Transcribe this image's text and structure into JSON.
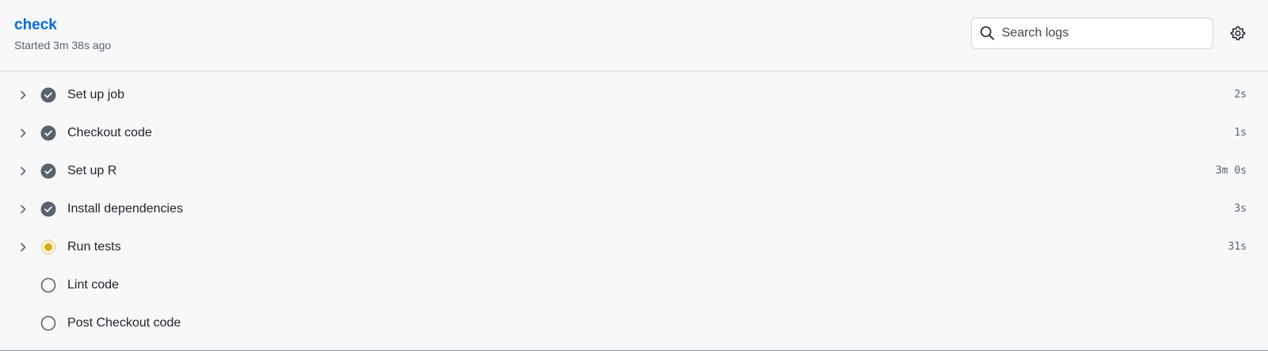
{
  "job": {
    "title": "check",
    "subtitle": "Started 3m 38s ago"
  },
  "search": {
    "placeholder": "Search logs",
    "value": ""
  },
  "icons": {
    "search": "search-icon",
    "settings": "gear-icon",
    "expand": "chevron-right-icon",
    "success": "check-circle-fill-icon",
    "in_progress": "dot-fill-icon",
    "pending": "circle-icon"
  },
  "colors": {
    "title": "#0969da",
    "success": "#59636e",
    "in_progress": "#dbab0a",
    "pending": "#59636e"
  },
  "steps": [
    {
      "name": "Set up job",
      "duration": "2s",
      "status": "success",
      "expandable": true
    },
    {
      "name": "Checkout code",
      "duration": "1s",
      "status": "success",
      "expandable": true
    },
    {
      "name": "Set up R",
      "duration": "3m 0s",
      "status": "success",
      "expandable": true
    },
    {
      "name": "Install dependencies",
      "duration": "3s",
      "status": "success",
      "expandable": true
    },
    {
      "name": "Run tests",
      "duration": "31s",
      "status": "in_progress",
      "expandable": true
    },
    {
      "name": "Lint code",
      "duration": "",
      "status": "pending",
      "expandable": false
    },
    {
      "name": "Post Checkout code",
      "duration": "",
      "status": "pending",
      "expandable": false
    }
  ]
}
